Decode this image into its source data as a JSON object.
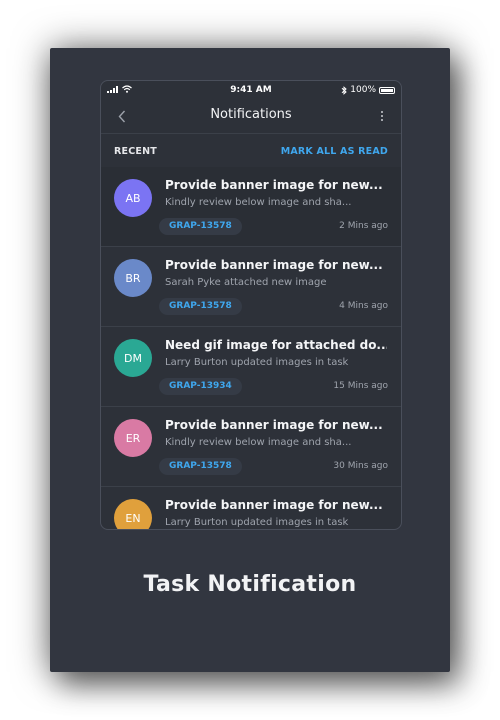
{
  "status": {
    "time": "9:41 AM",
    "battery": "100%"
  },
  "header": {
    "title": "Notifications"
  },
  "section": {
    "label": "RECENT",
    "action": "MARK ALL AS READ"
  },
  "notifications": [
    {
      "initials": "AB",
      "color": "#7b74f3",
      "title": "Provide banner image for new...",
      "subtitle": "Kindly review below image and sha...",
      "tag": "GRAP-13578",
      "time": "2 Mins ago"
    },
    {
      "initials": "BR",
      "color": "#6a89c9",
      "title": "Provide banner image for new...",
      "subtitle": "Sarah Pyke attached new image",
      "tag": "GRAP-13578",
      "time": "4 Mins ago"
    },
    {
      "initials": "DM",
      "color": "#2aa894",
      "title": "Need gif image for attached do...",
      "subtitle": "Larry Burton updated images in task",
      "tag": "GRAP-13934",
      "time": "15 Mins ago"
    },
    {
      "initials": "ER",
      "color": "#d97aa4",
      "title": "Provide banner image for new...",
      "subtitle": "Kindly review below image and sha...",
      "tag": "GRAP-13578",
      "time": "30 Mins ago"
    },
    {
      "initials": "EN",
      "color": "#e0a03c",
      "title": "Provide banner image for new...",
      "subtitle": "Larry Burton updated images in task",
      "tag": "",
      "time": ""
    }
  ],
  "caption": "Task Notification",
  "colors": {
    "accent": "#3fa7ee",
    "background": "#323640"
  }
}
